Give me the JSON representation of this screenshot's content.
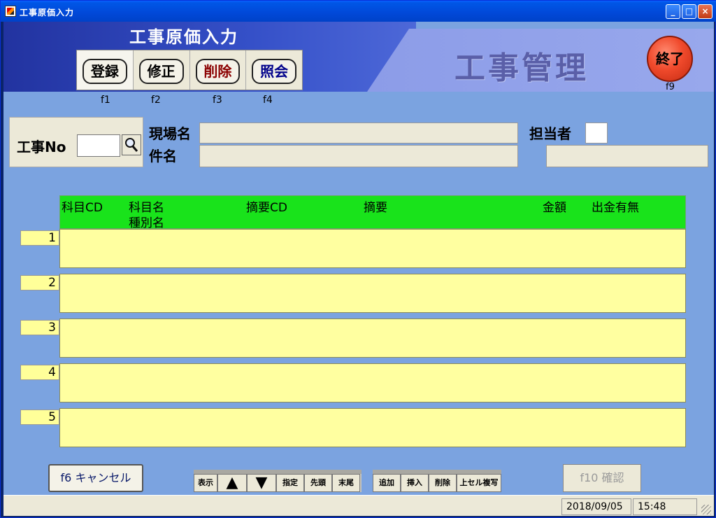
{
  "window": {
    "title": "工事原価入力"
  },
  "header": {
    "title": "工事原価入力",
    "brand": "工事管理",
    "tabs": [
      {
        "label": "登録",
        "key": "f1",
        "color": "#000000"
      },
      {
        "label": "修正",
        "key": "f2",
        "color": "#000000"
      },
      {
        "label": "削除",
        "key": "f3",
        "color": "#8b0000"
      },
      {
        "label": "照会",
        "key": "f4",
        "color": "#00008b"
      }
    ],
    "exit": {
      "label": "終了",
      "key": "f9"
    }
  },
  "filters": {
    "kouji_no_label": "工事No",
    "kouji_no_value": "",
    "genba_label": "現場名",
    "kenmei_label": "件名",
    "tantou_label": "担当者"
  },
  "grid": {
    "columns": [
      "科目CD",
      "科目名",
      "種別名",
      "摘要CD",
      "摘要",
      "金額",
      "出金有無"
    ],
    "rows": [
      {
        "num": "1"
      },
      {
        "num": "2"
      },
      {
        "num": "3"
      },
      {
        "num": "4"
      },
      {
        "num": "5"
      }
    ]
  },
  "footer": {
    "cancel": "f6 キャンセル",
    "nav_display": "表示",
    "nav_up": "▲",
    "nav_down": "▼",
    "nav_buttons": [
      "指定",
      "先頭",
      "末尾"
    ],
    "edit_buttons": [
      "追加",
      "挿入",
      "削除",
      "上セル複写"
    ],
    "confirm": "f10 確認"
  },
  "status": {
    "date": "2018/09/05",
    "time": "15:48"
  },
  "colors": {
    "grid_header": "#19e31b",
    "grid_row": "#ffffa0",
    "background": "#7ba3e0"
  }
}
